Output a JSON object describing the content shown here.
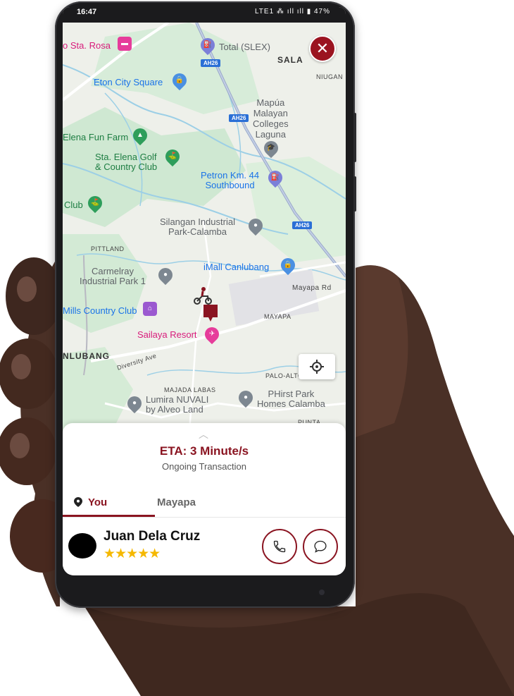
{
  "status_bar": {
    "time": "16:47",
    "indicators": "LTE1 ⁂ ıll ıll ▮ 47%"
  },
  "map": {
    "places": [
      {
        "label": "o Sta. Rosa",
        "color": "pink"
      },
      {
        "label": "Total (SLEX)",
        "color": "gray"
      },
      {
        "label": "SALA",
        "color": "bold"
      },
      {
        "label": "NIUGAN",
        "color": "road"
      },
      {
        "label": "Eton City Square",
        "color": "blue"
      },
      {
        "label": "Mapúa\nMalayan\nColleges\nLaguna",
        "color": "gray"
      },
      {
        "label": "Elena Fun Farm",
        "color": "green"
      },
      {
        "label": "Sta. Elena Golf\n& Country Club",
        "color": "green"
      },
      {
        "label": "Petron Km. 44\nSouthbound",
        "color": "blue"
      },
      {
        "label": "Club",
        "color": "green"
      },
      {
        "label": "Silangan Industrial\nPark-Calamba",
        "color": "gray"
      },
      {
        "label": "PITTLAND",
        "color": "road"
      },
      {
        "label": "iMall Canlubang",
        "color": "blue"
      },
      {
        "label": "Carmelray\nIndustrial Park 1",
        "color": "gray"
      },
      {
        "label": "Mayapa Rd",
        "color": "road"
      },
      {
        "label": "Mills Country Club",
        "color": "blue"
      },
      {
        "label": "MAYAPA",
        "color": "road"
      },
      {
        "label": "Sailaya Resort",
        "color": "pink"
      },
      {
        "label": "NLUBANG",
        "color": "bold"
      },
      {
        "label": "Diversity Ave",
        "color": "road"
      },
      {
        "label": "PALO-ALTO",
        "color": "road"
      },
      {
        "label": "MAJADA LABAS",
        "color": "road"
      },
      {
        "label": "Lumira NUVALI\nby Alveo Land",
        "color": "gray"
      },
      {
        "label": "PHirst Park\nHomes Calamba",
        "color": "gray"
      },
      {
        "label": "PUNTA",
        "color": "road"
      }
    ],
    "road_shields": [
      "AH26",
      "AH26",
      "AH26"
    ],
    "close_icon": "close-icon",
    "locate_icon": "crosshair-icon",
    "colors": {
      "accent": "#8a1421",
      "close": "#9b1420"
    }
  },
  "sheet": {
    "eta": "ETA: 3 Minute/s",
    "status": "Ongoing Transaction",
    "tabs": [
      {
        "label": "You",
        "icon": "location-pin-icon",
        "active": true
      },
      {
        "label": "Mayapa",
        "active": false
      }
    ],
    "driver": {
      "name": "Juan Dela Cruz",
      "rating": 5,
      "stars": "★★★★★"
    },
    "call_icon": "phone-icon",
    "chat_icon": "chat-bubble-icon"
  }
}
